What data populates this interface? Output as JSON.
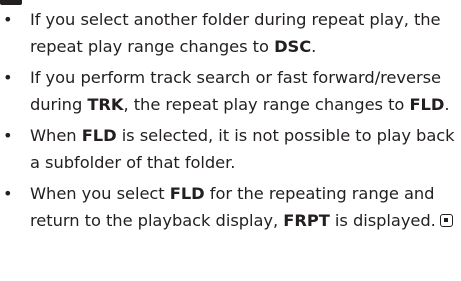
{
  "bullet_glyph": "•",
  "notes": [
    {
      "t1": "If you select another folder during repeat play, the repeat play range changes to ",
      "b1": "DSC",
      "t2": "."
    },
    {
      "t1": "If you perform track search or fast forward/reverse during ",
      "b1": "TRK",
      "t2": ", the repeat play range changes to ",
      "b2": "FLD",
      "t3": "."
    },
    {
      "t1": "When ",
      "b1": "FLD",
      "t2": " is selected, it is not possible to play back a subfolder of that folder."
    },
    {
      "t1": "When you select ",
      "b1": "FLD",
      "t2": " for the repeating range and return to the playback display, ",
      "b2": "FRPT",
      "t3": " is displayed."
    }
  ],
  "end_mark_icon": "end-of-section-icon"
}
